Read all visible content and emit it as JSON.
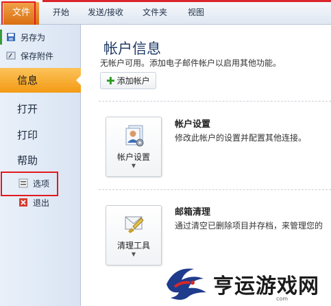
{
  "ribbon": {
    "tabs": [
      {
        "label": "文件",
        "selected": true
      },
      {
        "label": "开始"
      },
      {
        "label": "发送/接收"
      },
      {
        "label": "文件夹"
      },
      {
        "label": "视图"
      }
    ]
  },
  "nav": {
    "save_as": "另存为",
    "save_attachments": "保存附件",
    "info": "信息",
    "open": "打开",
    "print": "打印",
    "help": "帮助",
    "options": "选项",
    "exit": "退出"
  },
  "main": {
    "title": "帐户信息",
    "subtitle": "无帐户可用。添加电子邮件帐户以启用其他功能。",
    "add_account_label": "添加帐户",
    "account_settings": {
      "button_label": "帐户设置",
      "title": "帐户设置",
      "description": "修改此帐户的设置并配置其他连接。"
    },
    "cleanup": {
      "button_label": "清理工具",
      "title": "邮箱清理",
      "description": "通过清空已删除项目并存档，来管理您的"
    }
  },
  "watermark": {
    "text": "亨运游戏网",
    "url": "com"
  },
  "colors": {
    "file_tab": "#e07a1f",
    "info_selected": "#f5a623",
    "highlight_box": "#e3181f",
    "title_blue": "#1f3a66"
  }
}
